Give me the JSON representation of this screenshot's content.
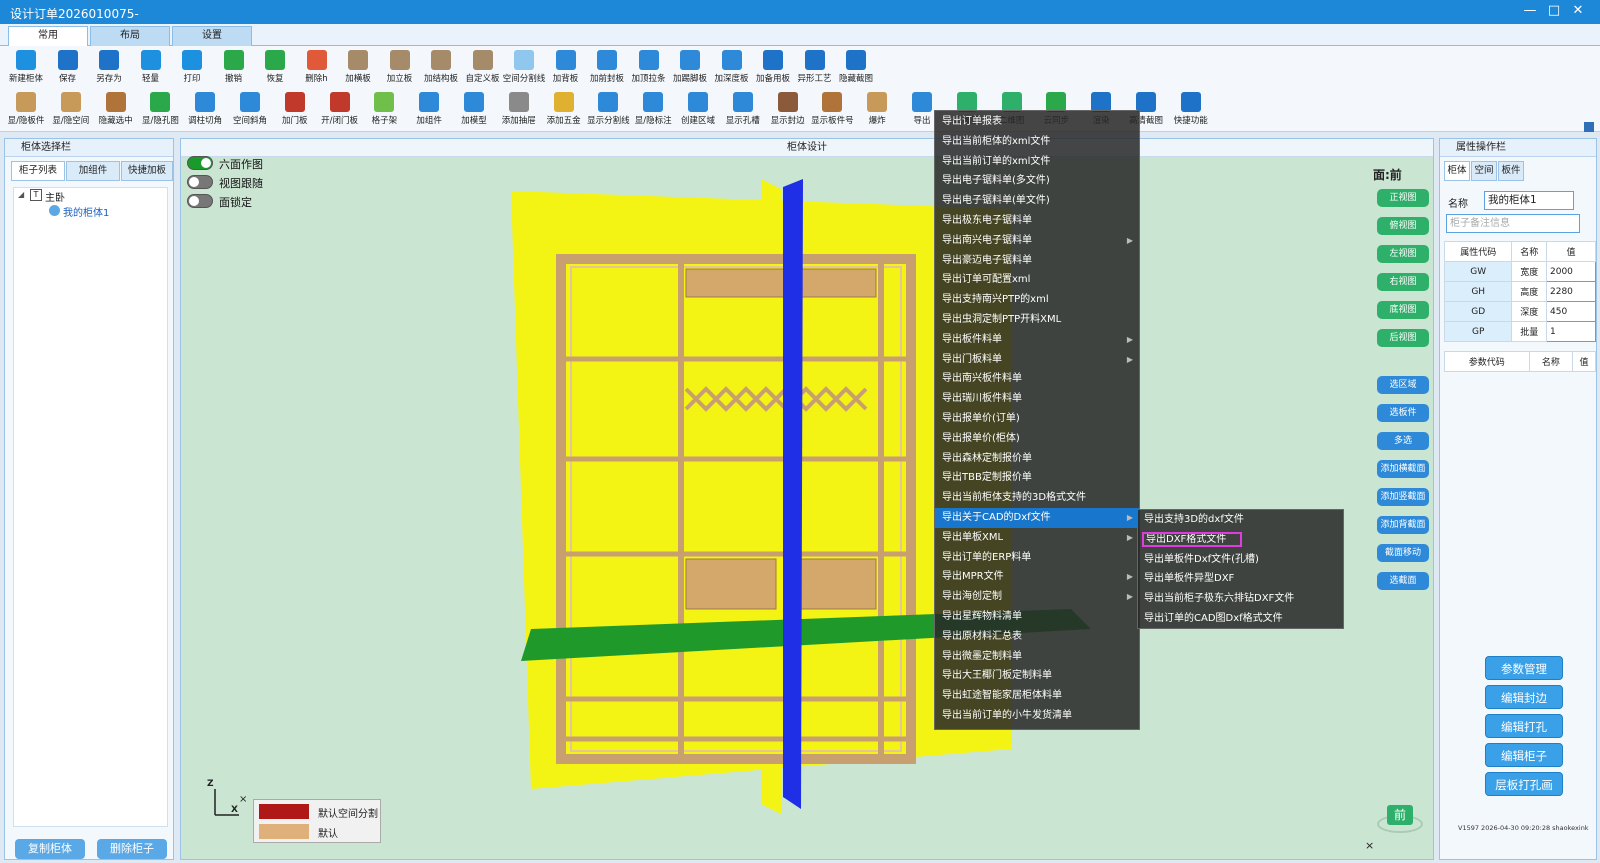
{
  "window": {
    "title": "设计订单2026010075-"
  },
  "tabs": [
    "常用",
    "布局",
    "设置"
  ],
  "ribbon_row1": [
    {
      "label": "新建柜体",
      "icon": "new-cabinet-icon",
      "color": "#1e90e0"
    },
    {
      "label": "保存",
      "icon": "save-icon",
      "color": "#1e73c8"
    },
    {
      "label": "另存为",
      "icon": "save-as-icon",
      "color": "#1e73c8"
    },
    {
      "label": "轻量",
      "icon": "lightweight-icon",
      "color": "#1e90e0"
    },
    {
      "label": "打印",
      "icon": "print-icon",
      "color": "#1e90e0"
    },
    {
      "label": "撤销",
      "icon": "undo-icon",
      "color": "#2aa84a"
    },
    {
      "label": "恢复",
      "icon": "redo-icon",
      "color": "#2aa84a"
    },
    {
      "label": "删除h",
      "icon": "delete-icon",
      "color": "#e05a3a"
    },
    {
      "label": "加横板",
      "icon": "add-horizontal-board-icon",
      "color": "#a68b6a"
    },
    {
      "label": "加立板",
      "icon": "add-vertical-board-icon",
      "color": "#a68b6a"
    },
    {
      "label": "加结构板",
      "icon": "add-structure-board-icon",
      "color": "#a68b6a"
    },
    {
      "label": "自定义板",
      "icon": "custom-board-icon",
      "color": "#a68b6a"
    },
    {
      "label": "空间分割线",
      "icon": "space-split-icon",
      "color": "#8fc7ef"
    },
    {
      "label": "加背板",
      "icon": "add-back-board-icon",
      "color": "#2e8ad8"
    },
    {
      "label": "加前封板",
      "icon": "add-front-seal-icon",
      "color": "#2e8ad8"
    },
    {
      "label": "加顶拉条",
      "icon": "add-top-strip-icon",
      "color": "#2e8ad8"
    },
    {
      "label": "加踢脚板",
      "icon": "add-kickboard-icon",
      "color": "#2e8ad8"
    },
    {
      "label": "加深度板",
      "icon": "add-depth-board-icon",
      "color": "#2e8ad8"
    },
    {
      "label": "加备用板",
      "icon": "add-spare-board-icon",
      "color": "#1e73c8"
    },
    {
      "label": "异形工艺",
      "icon": "special-shape-icon",
      "color": "#1e73c8"
    },
    {
      "label": "隐藏截图",
      "icon": "hide-screenshot-icon",
      "color": "#1e73c8"
    }
  ],
  "ribbon_row2": [
    {
      "label": "显/隐板件",
      "icon": "toggle-board-icon",
      "color": "#c79a5a"
    },
    {
      "label": "显/隐空间",
      "icon": "toggle-space-icon",
      "color": "#c79a5a"
    },
    {
      "label": "隐藏选中",
      "icon": "hide-selected-icon",
      "color": "#b0743a"
    },
    {
      "label": "显/隐孔图",
      "icon": "toggle-hole-icon",
      "color": "#2aa84a"
    },
    {
      "label": "调柱切角",
      "icon": "column-corner-icon",
      "color": "#2e8ad8"
    },
    {
      "label": "空间斜角",
      "icon": "space-bevel-icon",
      "color": "#2e8ad8"
    },
    {
      "label": "加门板",
      "icon": "add-door-icon",
      "color": "#c0392b"
    },
    {
      "label": "开/闭门板",
      "icon": "open-close-door-icon",
      "color": "#c0392b"
    },
    {
      "label": "格子架",
      "icon": "grid-rack-icon",
      "color": "#6fbf4a"
    },
    {
      "label": "加组件",
      "icon": "add-component-icon",
      "color": "#2e8ad8"
    },
    {
      "label": "加模型",
      "icon": "add-model-icon",
      "color": "#2e8ad8"
    },
    {
      "label": "添加抽屉",
      "icon": "add-drawer-icon",
      "color": "#8a8a8a"
    },
    {
      "label": "添加五金",
      "icon": "add-hardware-icon",
      "color": "#e0b030"
    },
    {
      "label": "显示分割线",
      "icon": "show-split-icon",
      "color": "#2e8ad8"
    },
    {
      "label": "显/隐标注",
      "icon": "toggle-dimension-icon",
      "color": "#2e8ad8"
    },
    {
      "label": "创建区域",
      "icon": "create-region-icon",
      "color": "#2e8ad8"
    },
    {
      "label": "显示孔槽",
      "icon": "show-holes-icon",
      "color": "#2e8ad8"
    },
    {
      "label": "显示封边",
      "icon": "show-edge-icon",
      "color": "#8a5a3a"
    },
    {
      "label": "显示板件号",
      "icon": "show-board-number-icon",
      "color": "#b0743a"
    },
    {
      "label": "爆炸",
      "icon": "explode-icon",
      "color": "#c79a5a"
    },
    {
      "label": "导出",
      "icon": "export-icon",
      "color": "#2e8ad8"
    },
    {
      "label": "三维图",
      "icon": "3d-view-icon",
      "color": "#2eb06a"
    },
    {
      "label": "二维图",
      "icon": "2d-view-icon",
      "color": "#2eb06a"
    },
    {
      "label": "云同步",
      "icon": "cloud-sync-icon",
      "color": "#2aa84a"
    },
    {
      "label": "渲染",
      "icon": "render-icon",
      "color": "#1e73c8"
    },
    {
      "label": "高清截图",
      "icon": "hd-screenshot-icon",
      "color": "#1e73c8"
    },
    {
      "label": "快捷功能",
      "icon": "quick-function-icon",
      "color": "#1e73c8"
    }
  ],
  "left_panel": {
    "title": "柜体选择栏",
    "tabs": [
      "柜子列表",
      "加组件",
      "快捷加板"
    ],
    "tree_root": "主卧",
    "tree_child": "我的柜体1",
    "copy_button": "复制柜体",
    "delete_button": "删除柜子"
  },
  "viewport": {
    "title": "柜体设计",
    "toggles": [
      {
        "label": "六面作图",
        "on": true
      },
      {
        "label": "视图跟随",
        "on": false
      },
      {
        "label": "面锁定",
        "on": false
      }
    ],
    "face_label": "面:前",
    "view_buttons": [
      "正视图",
      "俯视图",
      "左视图",
      "右视图",
      "底视图",
      "后视图"
    ],
    "action_buttons": [
      "选区域",
      "选板件",
      "多选",
      "添加横截面",
      "添加竖截面",
      "添加背截面",
      "截面移动",
      "选截面"
    ],
    "legend": [
      {
        "label": "默认空间分割",
        "color": "#b01818"
      },
      {
        "label": "默认",
        "color": "#e0b07a"
      }
    ],
    "nav_cube_label": "前",
    "axis_z": "Z",
    "axis_x": "X",
    "close_glyph": "×"
  },
  "context_menu": {
    "items": [
      {
        "label": "导出订单报表",
        "sub": false
      },
      {
        "label": "导出当前柜体的xml文件",
        "sub": false
      },
      {
        "label": "导出当前订单的xml文件",
        "sub": false
      },
      {
        "label": "导出电子锯料单(多文件)",
        "sub": false
      },
      {
        "label": "导出电子锯料单(单文件)",
        "sub": false
      },
      {
        "label": "导出极东电子锯料单",
        "sub": false
      },
      {
        "label": "导出南兴电子锯料单",
        "sub": true
      },
      {
        "label": "导出豪迈电子锯料单",
        "sub": false
      },
      {
        "label": "导出订单可配置xml",
        "sub": false
      },
      {
        "label": "导出支持南兴PTP的xml",
        "sub": false
      },
      {
        "label": "导出虫洞定制PTP开料XML",
        "sub": false
      },
      {
        "label": "导出板件料单",
        "sub": true
      },
      {
        "label": "导出门板料单",
        "sub": true
      },
      {
        "label": "导出南兴板件料单",
        "sub": false
      },
      {
        "label": "导出瑞川板件料单",
        "sub": false
      },
      {
        "label": "导出报单价(订单)",
        "sub": false
      },
      {
        "label": "导出报单价(柜体)",
        "sub": false
      },
      {
        "label": "导出森林定制报价单",
        "sub": false
      },
      {
        "label": "导出TBB定制报价单",
        "sub": false
      },
      {
        "label": "导出当前柜体支持的3D格式文件",
        "sub": false
      },
      {
        "label": "导出关于CAD的Dxf文件",
        "sub": true
      },
      {
        "label": "导出单板XML",
        "sub": true
      },
      {
        "label": "导出订单的ERP料单",
        "sub": false
      },
      {
        "label": "导出MPR文件",
        "sub": true
      },
      {
        "label": "导出海创定制",
        "sub": true
      },
      {
        "label": "导出星辉物料清单",
        "sub": false
      },
      {
        "label": "导出原材料汇总表",
        "sub": false
      },
      {
        "label": "导出微墨定制料单",
        "sub": false
      },
      {
        "label": "导出大王椰门板定制料单",
        "sub": false
      },
      {
        "label": "导出虹途智能家居柜体料单",
        "sub": false
      },
      {
        "label": "导出当前订单的小牛发货清单",
        "sub": false
      }
    ],
    "highlighted_index": 20
  },
  "submenu": {
    "items": [
      "导出支持3D的dxf文件",
      "导出DXF格式文件",
      "导出单板件Dxf文件(孔槽)",
      "导出单板件异型DXF",
      "导出当前柜子极东六排钻DXF文件",
      "导出订单的CAD图Dxf格式文件"
    ],
    "boxed_index": 1
  },
  "right_panel": {
    "title": "属性操作栏",
    "tabs": [
      "柜体",
      "空间",
      "板件"
    ],
    "name_label": "名称",
    "name_value": "我的柜体1",
    "remark_placeholder": "柜子备注信息",
    "prop_headers": [
      "属性代码",
      "名称",
      "值"
    ],
    "props": [
      {
        "code": "GW",
        "name": "宽度",
        "value": "2000"
      },
      {
        "code": "GH",
        "name": "高度",
        "value": "2280"
      },
      {
        "code": "GD",
        "name": "深度",
        "value": "450"
      },
      {
        "code": "GP",
        "name": "批量",
        "value": "1"
      }
    ],
    "param_headers": [
      "参数代码",
      "名称",
      "值"
    ],
    "buttons": [
      "参数管理",
      "编辑封边",
      "编辑打孔",
      "编辑柜子",
      "层板打孔画"
    ],
    "version": "V1597 2026-04-30 09:20:28 shaokexink"
  },
  "window_buttons": {
    "minimize": "—",
    "maximize": "□",
    "close": "✕"
  }
}
